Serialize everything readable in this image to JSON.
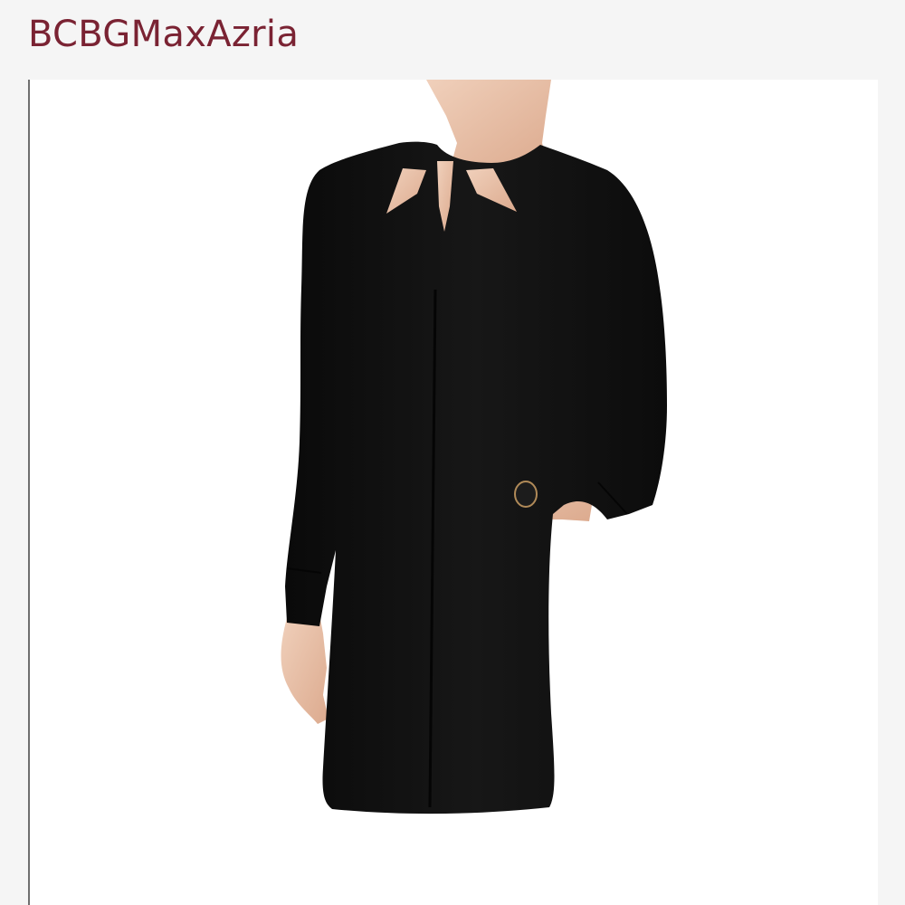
{
  "header": {
    "brand_name": "BCBGMaxAzria"
  },
  "product": {
    "image_icon": "dress-photo",
    "colors": {
      "brand": "#7a2333",
      "dress": "#121212",
      "skin": "#e9c4ab"
    }
  }
}
